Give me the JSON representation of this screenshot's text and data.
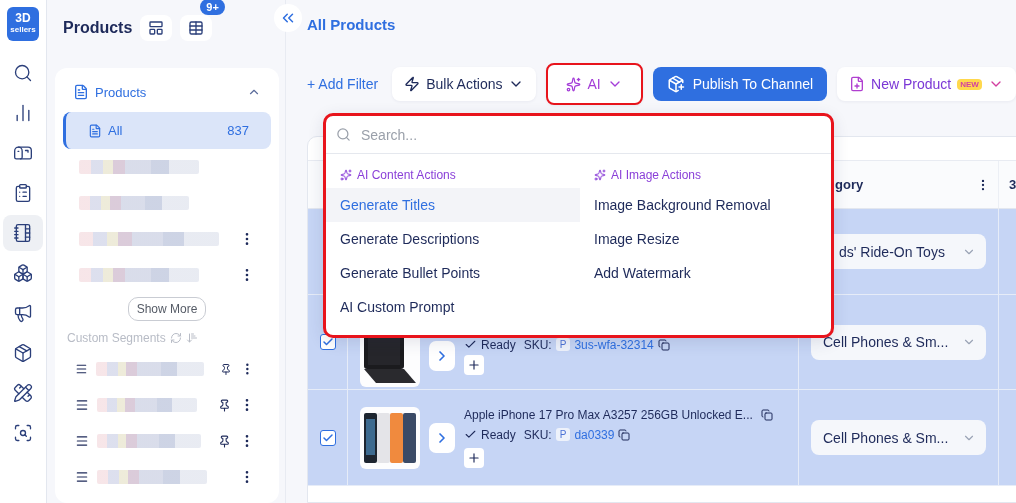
{
  "logo": {
    "line_1": "3D",
    "line_2": "sellers"
  },
  "nav_rail": [
    {
      "kind": "search",
      "selected": false
    },
    {
      "kind": "chart",
      "selected": false
    },
    {
      "kind": "mailbox",
      "selected": false
    },
    {
      "kind": "clipboard",
      "selected": false
    },
    {
      "kind": "notebook",
      "selected": true
    },
    {
      "kind": "boxes",
      "selected": false
    },
    {
      "kind": "megaphone",
      "selected": false
    },
    {
      "kind": "package",
      "selected": false
    },
    {
      "kind": "tools",
      "selected": false
    },
    {
      "kind": "analytics",
      "selected": false
    }
  ],
  "sidebar": {
    "title": "Products",
    "badge": "9+",
    "group": {
      "label": "Products",
      "expanded": true
    },
    "items": [
      {
        "label": "All",
        "count": "837",
        "selected": true
      }
    ],
    "collections": [
      {
        "menu": false
      },
      {
        "menu": false
      },
      {
        "menu": true
      },
      {
        "menu": true
      }
    ],
    "show_more": "Show More",
    "custom_segments": {
      "label": "Custom Segments"
    },
    "segments": [
      {
        "pinned": true
      },
      {
        "pinned": true
      },
      {
        "pinned": true
      },
      {
        "pinned": false
      }
    ]
  },
  "main": {
    "title": "All Products",
    "toolbar": {
      "add_filter": "+ Add Filter",
      "bulk_actions": "Bulk Actions",
      "ai": {
        "label": "AI",
        "highlighted": true
      },
      "publish": "Publish To Channel",
      "new_product": "New Product",
      "new_badge": "NEW"
    },
    "dropdown": {
      "highlighted": true,
      "search": {
        "placeholder": "Search..."
      },
      "sections": [
        {
          "title": "AI Content Actions",
          "items": [
            {
              "label": "Generate Titles",
              "selected": true
            },
            {
              "label": "Generate Descriptions",
              "selected": false
            },
            {
              "label": "Generate Bullet Points",
              "selected": false
            },
            {
              "label": "AI Custom Prompt",
              "selected": false
            }
          ]
        },
        {
          "title": "AI Image Actions",
          "items": [
            {
              "label": "Image Background Removal",
              "selected": false
            },
            {
              "label": "Image Resize",
              "selected": false
            },
            {
              "label": "Add Watermark",
              "selected": false
            }
          ]
        }
      ]
    },
    "table": {
      "columns": [
        {
          "label": "gory"
        },
        {
          "label": "3"
        }
      ],
      "rows": [
        {
          "category": "ds' Ride-On Toys"
        },
        {
          "checked": true,
          "status": "Ready",
          "sku_label": "SKU:",
          "sku_prefix": "P",
          "sku": "3us-wfa-32314",
          "category": "Cell Phones & Sm..."
        },
        {
          "checked": true,
          "title": "Apple iPhone 17 Pro Max A3257 256GB Unlocked E...",
          "status": "Ready",
          "sku_label": "SKU:",
          "sku_prefix": "P",
          "sku": "da0339",
          "category": "Cell Phones & Sm..."
        }
      ]
    }
  }
}
